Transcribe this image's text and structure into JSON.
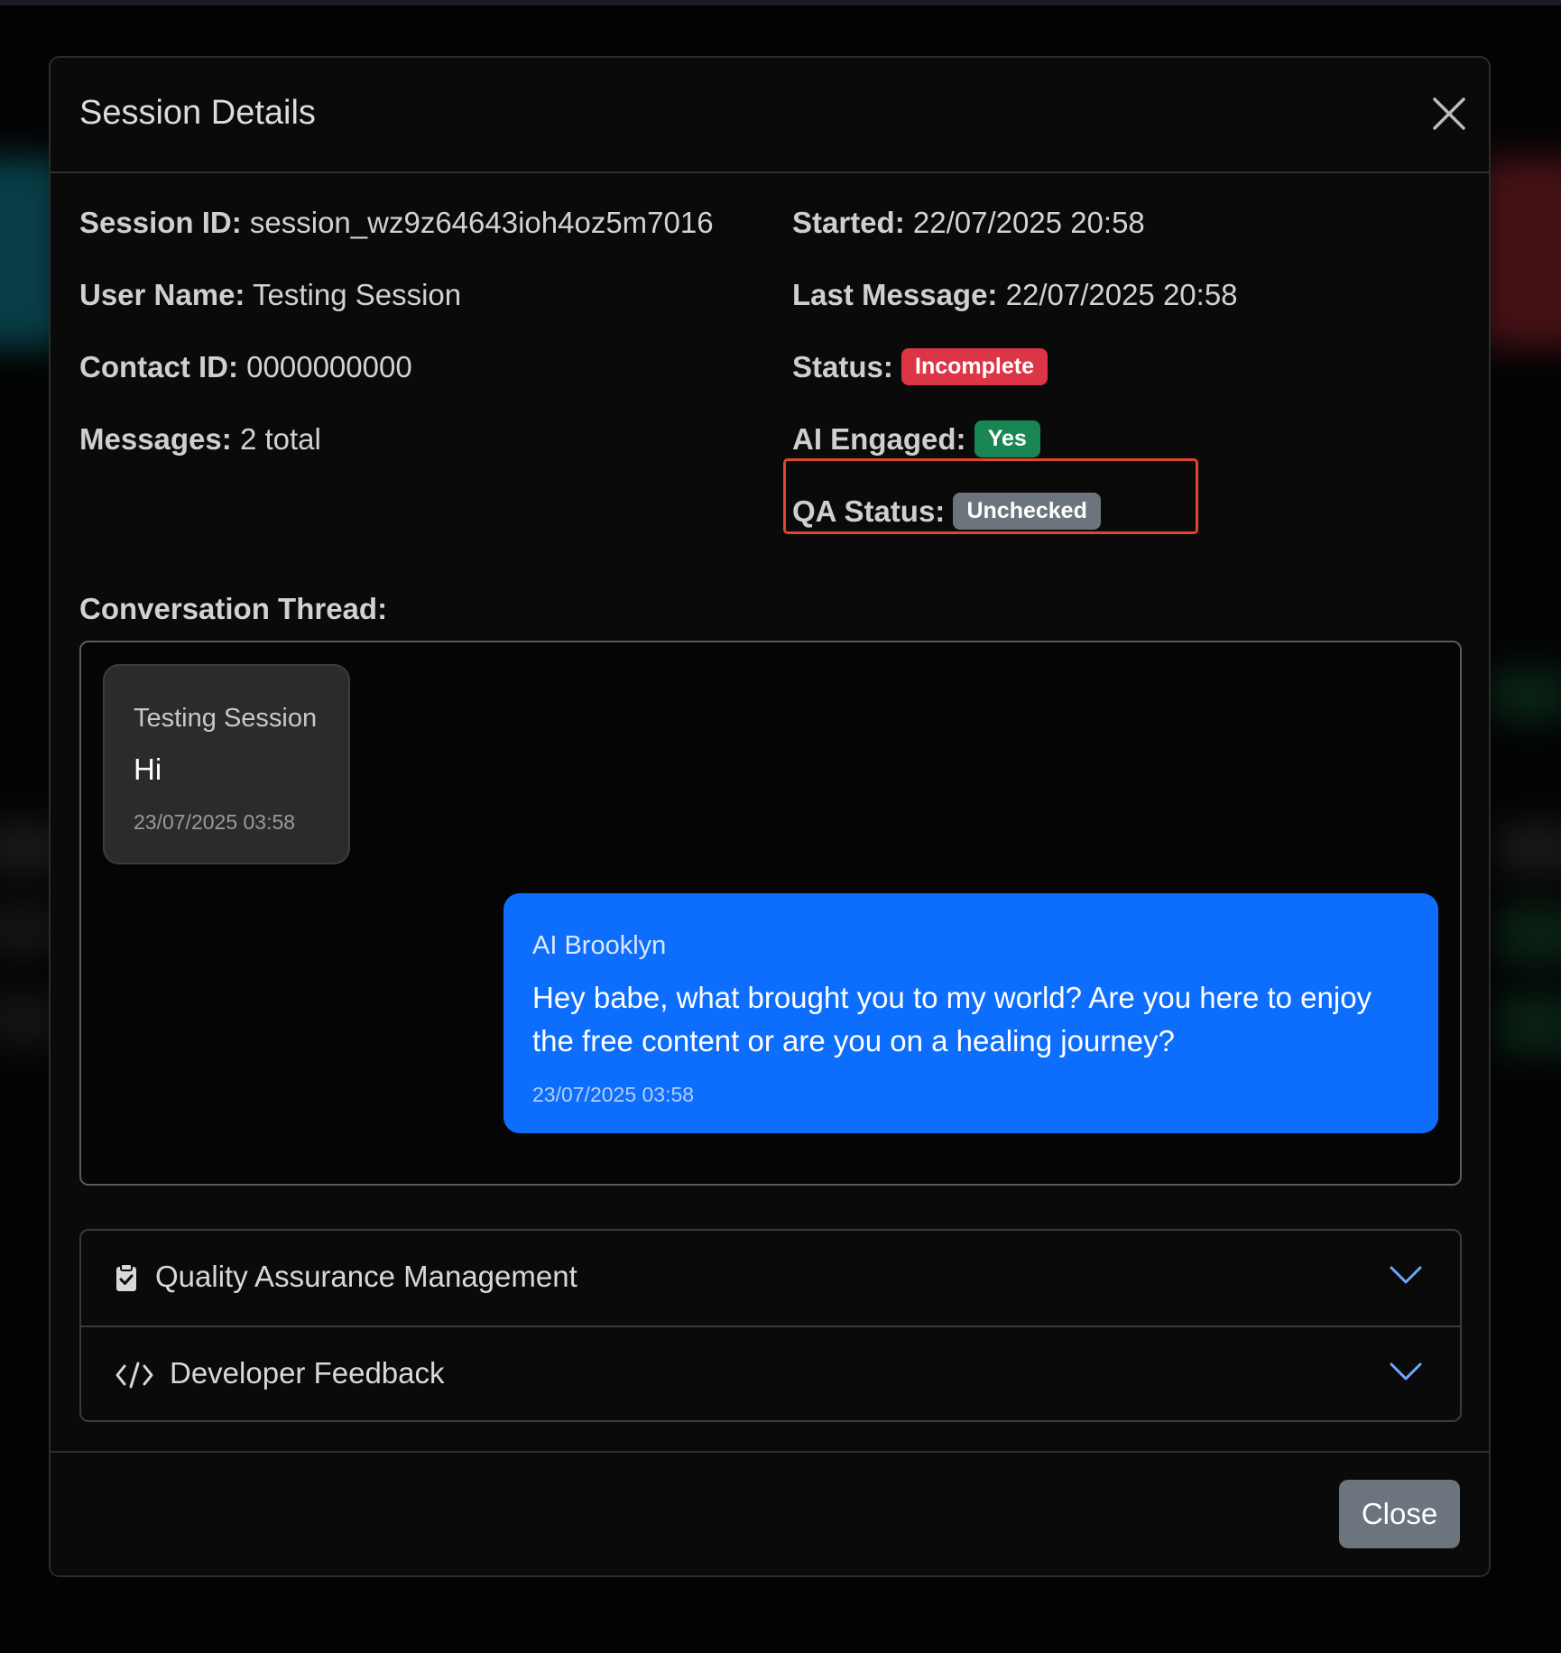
{
  "modal": {
    "title": "Session Details",
    "close_icon": "close-icon"
  },
  "details": {
    "session_id_label": "Session ID:",
    "session_id_value": "session_wz9z64643ioh4oz5m7016",
    "user_name_label": "User Name:",
    "user_name_value": "Testing Session",
    "contact_id_label": "Contact ID:",
    "contact_id_value": "0000000000",
    "messages_label": "Messages:",
    "messages_value": "2 total",
    "started_label": "Started:",
    "started_value": "22/07/2025 20:58",
    "last_message_label": "Last Message:",
    "last_message_value": "22/07/2025 20:58",
    "status_label": "Status:",
    "status_badge": "Incomplete",
    "ai_engaged_label": "AI Engaged:",
    "ai_engaged_badge": "Yes",
    "qa_status_label": "QA Status:",
    "qa_status_badge": "Unchecked"
  },
  "thread": {
    "label": "Conversation Thread:",
    "messages": [
      {
        "sender": "Testing Session",
        "text": "Hi",
        "time": "23/07/2025 03:58"
      },
      {
        "sender": "AI Brooklyn",
        "text": "Hey babe, what brought you to my world? Are you here to enjoy the free content or are you on a healing journey?",
        "time": "23/07/2025 03:58"
      }
    ]
  },
  "accordion": {
    "items": [
      {
        "label": "Quality Assurance Management",
        "icon": "clipboard-check-icon"
      },
      {
        "label": "Developer Feedback",
        "icon": "code-icon"
      }
    ]
  },
  "footer": {
    "close_label": "Close"
  },
  "colors": {
    "status_incomplete": "#dc3545",
    "ai_engaged_yes": "#198754",
    "qa_unchecked": "#6c757d",
    "ai_bubble": "#0d6efd",
    "highlight": "#e0452d"
  }
}
